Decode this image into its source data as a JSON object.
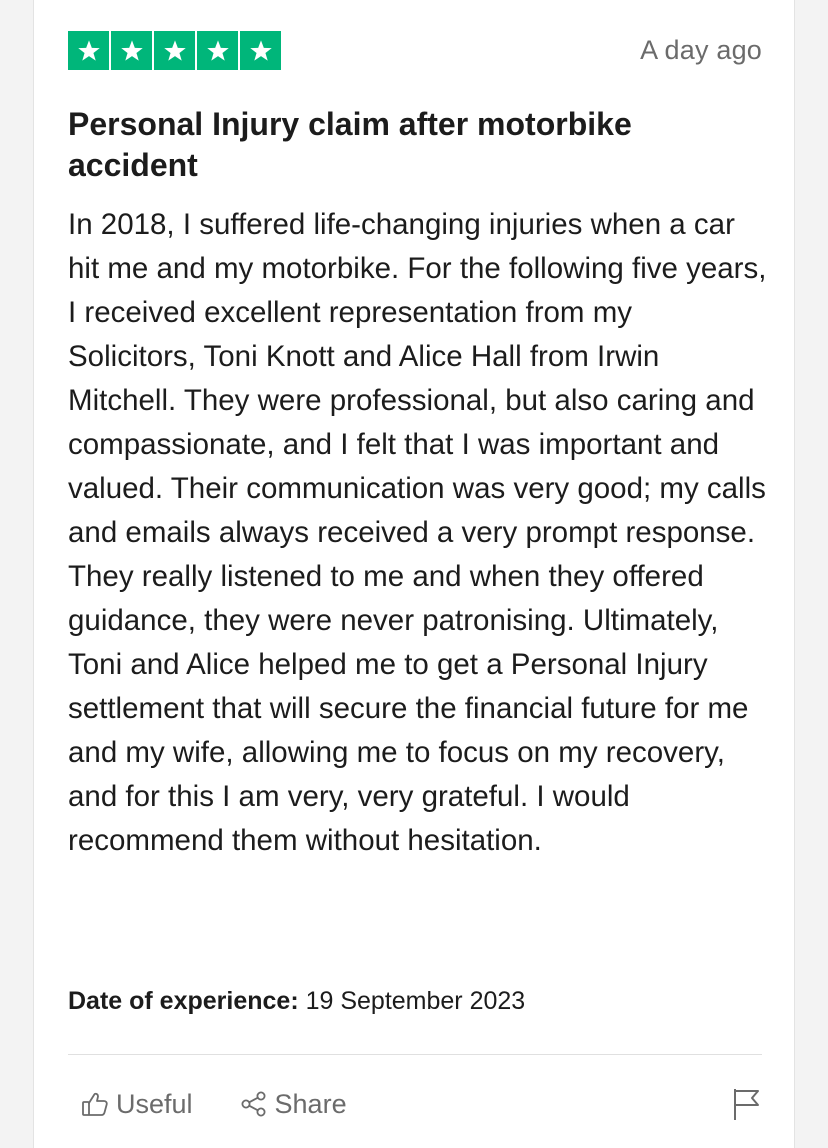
{
  "colors": {
    "star_green": "#00b67a",
    "text_primary": "#1c1c1c",
    "text_muted": "#6b6b6b"
  },
  "review": {
    "rating": 5,
    "date_ago": "A day ago",
    "title": "Personal Injury claim after motorbike accident",
    "body": "In 2018, I suffered life-changing injuries when a car hit me and my motorbike. For the following five years, I received excellent representation from my Solicitors, Toni Knott and Alice Hall from Irwin Mitchell. They were professional, but also caring and compassionate, and I felt that I was important and valued. Their communication was very good; my calls and emails always received a very prompt response. They really listened to me and when they offered guidance, they were never patronising. Ultimately, Toni and Alice helped me to get a Personal Injury settlement that will secure the financial future for me and my wife, allowing me to focus on my recovery, and for this I am very, very grateful. I would recommend them without hesitation.",
    "experience_label": "Date of experience:",
    "experience_date": "19 September 2023"
  },
  "actions": {
    "useful_label": "Useful",
    "useful_icon": "thumbs-up-icon",
    "share_label": "Share",
    "share_icon": "share-icon",
    "flag_icon": "flag-icon"
  }
}
